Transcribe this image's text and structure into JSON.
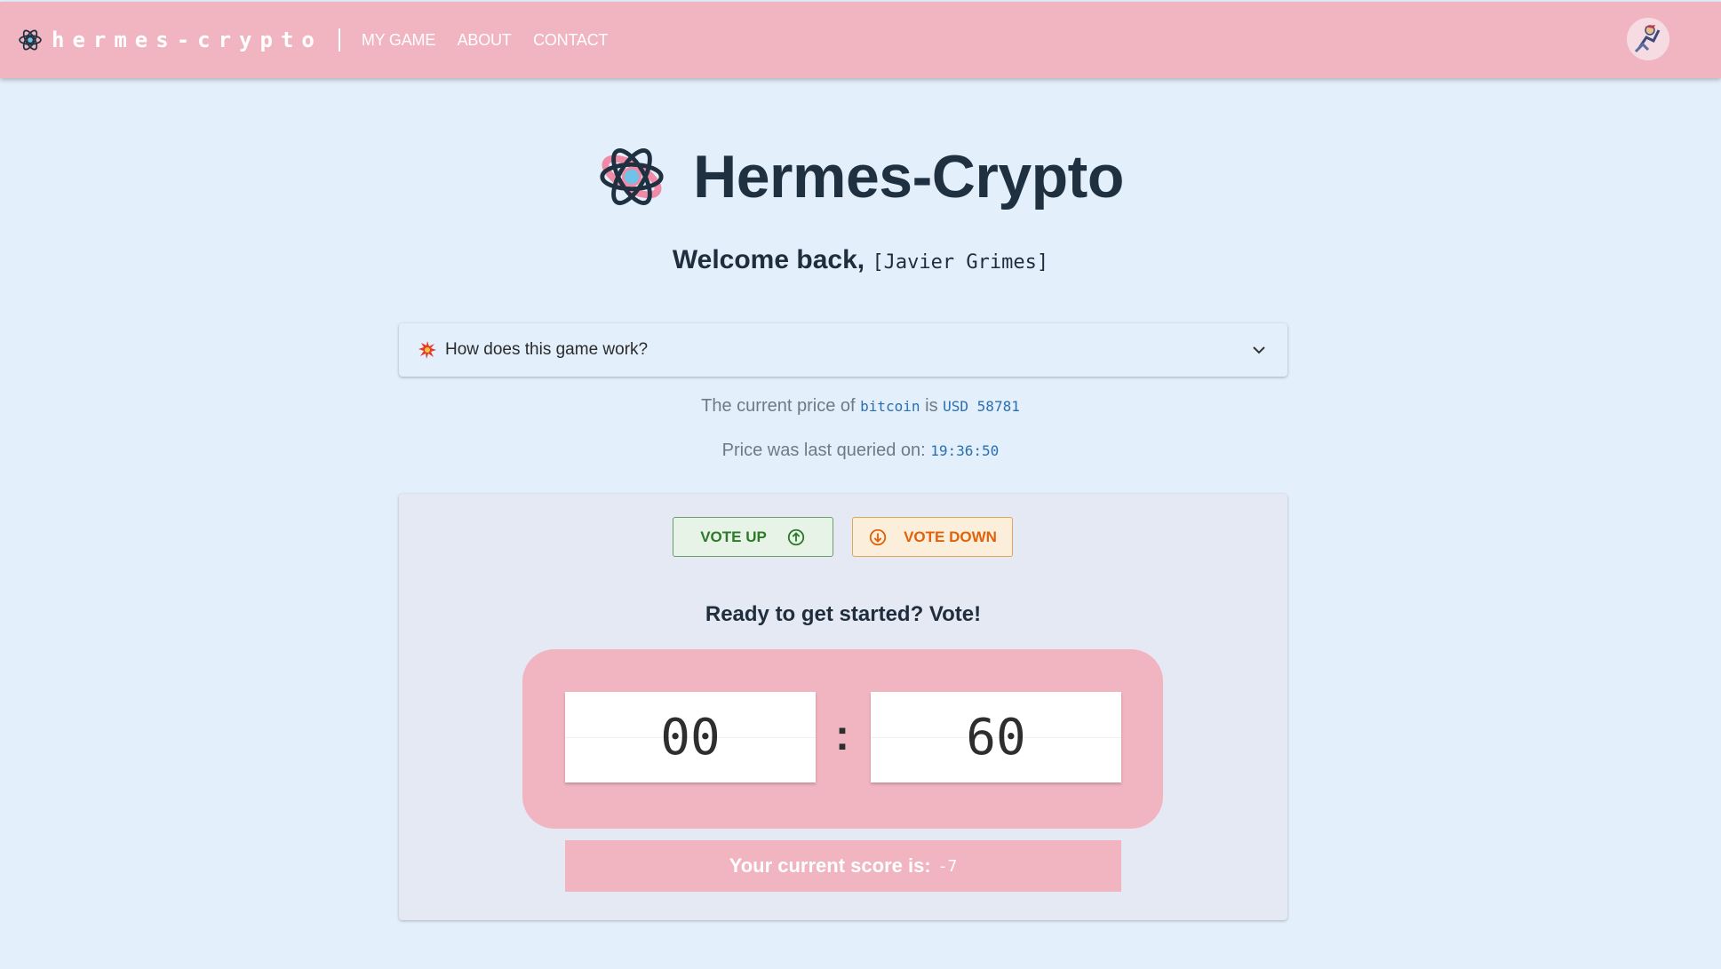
{
  "nav": {
    "brand": "hermes-crypto",
    "items": [
      "MY GAME",
      "ABOUT",
      "CONTACT"
    ]
  },
  "hero": {
    "title": "Hermes-Crypto"
  },
  "welcome": {
    "greeting": "Welcome back,",
    "user": "[Javier Grimes]"
  },
  "faq": {
    "question": "How does this game work?"
  },
  "price": {
    "prefix": "The current price of",
    "coin": "bitcoin",
    "middle": "is",
    "value": "USD 58781",
    "query_prefix": "Price was last queried on:",
    "query_time": "19:36:50"
  },
  "actions": {
    "vote_up": "VOTE UP",
    "vote_down": "VOTE DOWN"
  },
  "status": "Ready to get started? Vote!",
  "timer": {
    "minutes": "00",
    "separator": ":",
    "seconds": "60"
  },
  "score": {
    "label": "Your current score is:",
    "value": "-7"
  },
  "colors": {
    "navbar": "#f1b5c1",
    "background": "#e3effb",
    "vote_up": "#2d7a2a",
    "vote_down": "#e0620a",
    "code_text": "#2a6fb0"
  },
  "icons": {
    "brand": "atom-logo-icon",
    "avatar": "user-avatar",
    "faq": "burst-icon",
    "chevron": "chevron-down-icon",
    "vote_up": "arrow-up-circle-icon",
    "vote_down": "arrow-down-circle-icon"
  }
}
